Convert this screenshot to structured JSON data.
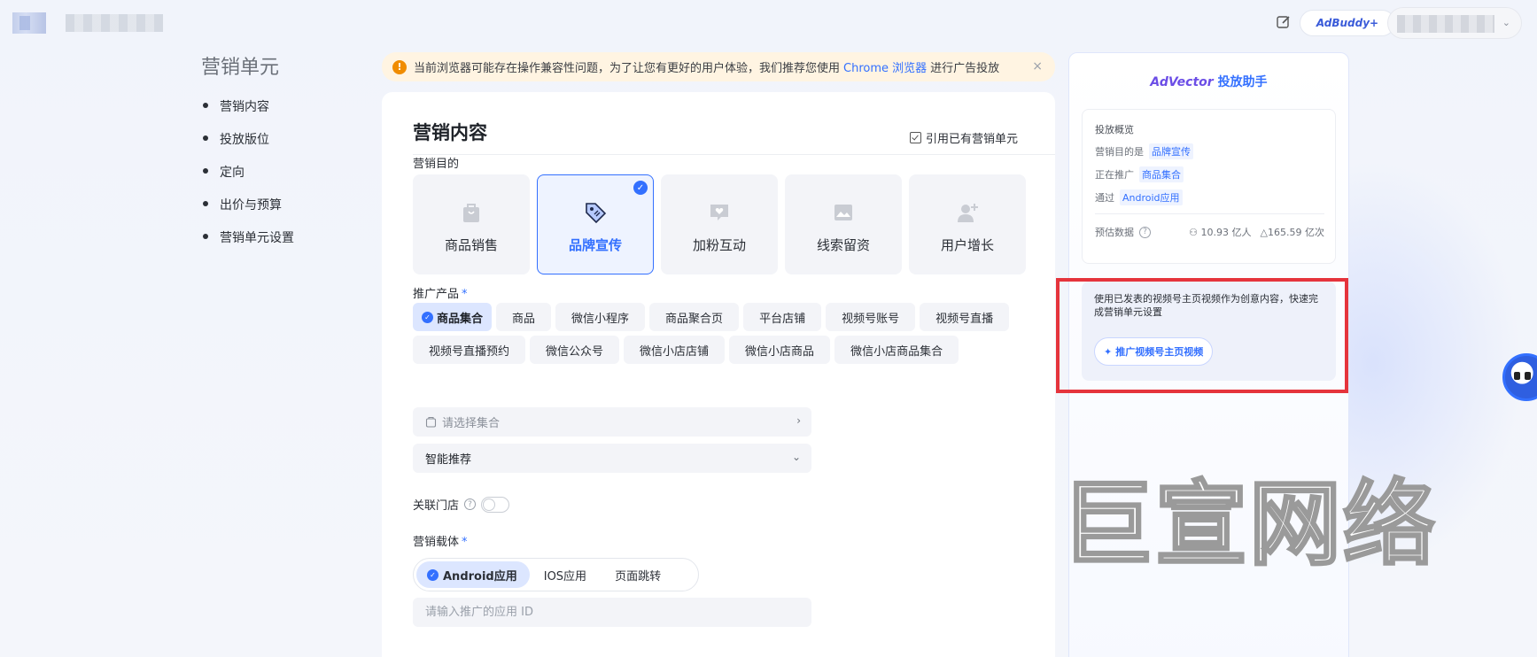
{
  "topbar": {
    "adbuddy_label": "AdBuddy+"
  },
  "nav": {
    "title": "营销单元",
    "items": [
      "营销内容",
      "投放版位",
      "定向",
      "出价与预算",
      "营销单元设置"
    ]
  },
  "banner": {
    "text_before": "当前浏览器可能存在操作兼容性问题，为了让您有更好的用户体验，我们推荐您使用",
    "link": "Chrome 浏览器",
    "text_after": "进行广告投放",
    "close": "×"
  },
  "main": {
    "title": "营销内容",
    "ref_link": "引用已有营销单元",
    "goal_label": "营销目的",
    "goals": [
      {
        "label": "商品销售",
        "icon": "shopping-bag-icon",
        "active": false
      },
      {
        "label": "品牌宣传",
        "icon": "brand-tag-icon",
        "active": true
      },
      {
        "label": "加粉互动",
        "icon": "heart-chat-icon",
        "active": false
      },
      {
        "label": "线索留资",
        "icon": "image-form-icon",
        "active": false
      },
      {
        "label": "用户增长",
        "icon": "add-user-icon",
        "active": false
      }
    ],
    "product_label": "推广产品",
    "required_mark": "*",
    "products": [
      "商品集合",
      "商品",
      "微信小程序",
      "商品聚合页",
      "平台店铺",
      "视频号账号",
      "视频号直播",
      "视频号直播预约",
      "微信公众号",
      "微信小店店铺",
      "微信小店商品",
      "微信小店商品集合"
    ],
    "selected_product_index": 0,
    "collection_placeholder": "请选择集合",
    "smart_select": "智能推荐",
    "store_label": "关联门店",
    "carrier_label": "营销载体",
    "carriers": [
      "Android应用",
      "IOS应用",
      "页面跳转"
    ],
    "app_id_placeholder": "请输入推广的应用 ID"
  },
  "assistant": {
    "brand": "AdVector",
    "title": "投放助手",
    "overview_title": "投放概览",
    "rows": [
      {
        "key": "营销目的是",
        "value": "品牌宣传"
      },
      {
        "key": "正在推广",
        "value": "商品集合"
      },
      {
        "key": "通过",
        "value": "Android应用"
      }
    ],
    "estimate_label": "预估数据",
    "estimate_users": "10.93 亿人",
    "estimate_times": "165.59 亿次",
    "tip_text": "使用已发表的视频号主页视频作为创意内容，快速完成营销单元设置",
    "promo_button": "推广视频号主页视频"
  },
  "watermark": "巨宣网络",
  "colors": {
    "accent": "#3370ff",
    "warning": "#f08c00",
    "highlight_border": "#e5343c"
  }
}
